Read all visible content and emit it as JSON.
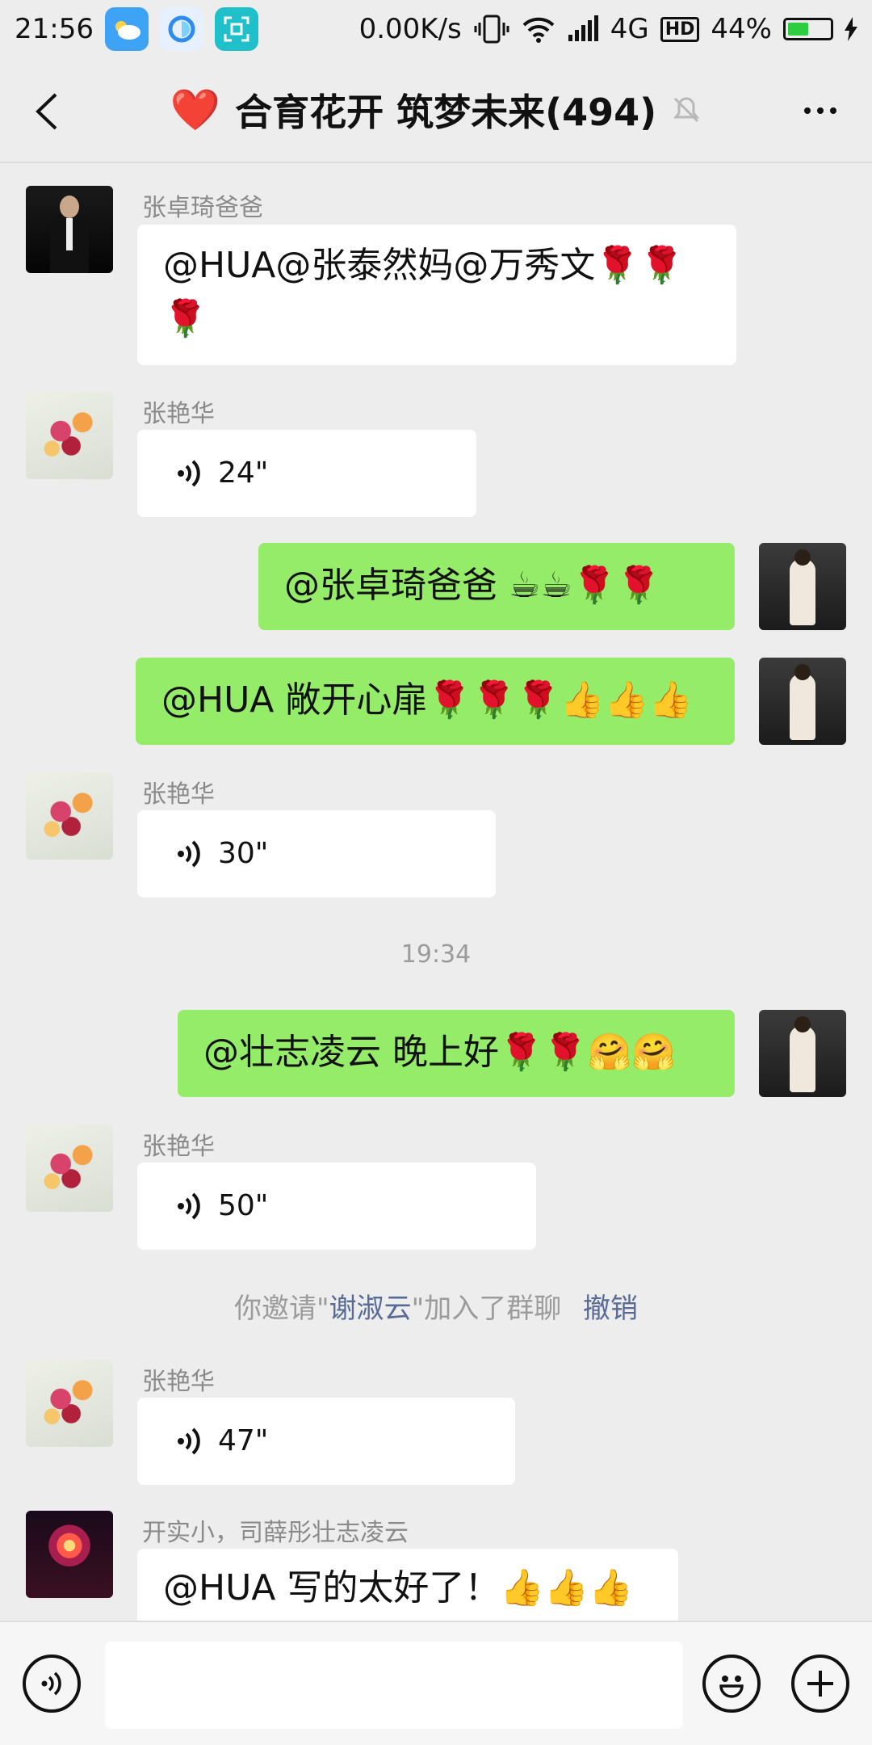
{
  "status_bar": {
    "time": "21:56",
    "speed": "0.00K/s",
    "network": "4G",
    "hd": "HD",
    "battery": "44%",
    "battery_level": 0.44
  },
  "header": {
    "title": "合育花开 筑梦未来(494)",
    "heart": "❤️",
    "back_icon": "chevron-left-icon",
    "mute_icon": "bell-off-icon",
    "more_icon": "more-icon"
  },
  "messages": [
    {
      "sender": "张卓琦爸爸",
      "text": "@HUA@张泰然妈@万秀文🌹🌹",
      "text2": "🌹"
    },
    {
      "sender": "张艳华",
      "voice": "24\""
    },
    {
      "text": "@张卓琦爸爸 ☕☕🌹🌹"
    },
    {
      "text": "@HUA 敞开心扉🌹🌹🌹👍👍👍"
    },
    {
      "sender": "张艳华",
      "voice": "30\""
    },
    {
      "text": "@壮志凌云 晚上好🌹🌹🤗🤗"
    },
    {
      "sender": "张艳华",
      "voice": "50\""
    },
    {
      "sender": "张艳华",
      "voice": "47\""
    },
    {
      "sender": "开实小，司薛彤壮志凌云",
      "text": "@HUA 写的太好了！👍👍👍"
    }
  ],
  "time_divider": "19:34",
  "system": {
    "prefix": "你邀请\"",
    "name": "谢淑云",
    "suffix": "\"加入了群聊",
    "action": "撤销"
  },
  "input_bar": {
    "voice_icon": "voice-icon",
    "emoji_icon": "emoji-icon",
    "plus_icon": "plus-icon",
    "placeholder": ""
  }
}
